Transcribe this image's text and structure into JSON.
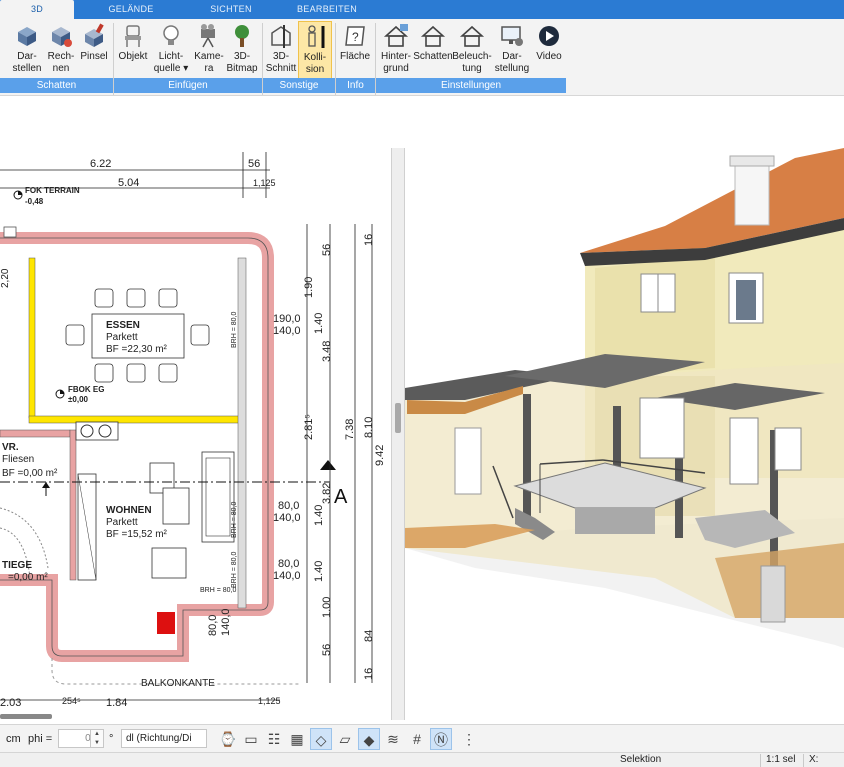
{
  "tabs": [
    {
      "label": "3D",
      "active": true
    },
    {
      "label": "GELÄNDE",
      "active": false
    },
    {
      "label": "SICHTEN",
      "active": false
    },
    {
      "label": "BEARBEITEN",
      "active": false
    }
  ],
  "ribbon": {
    "buttons": [
      {
        "l1": "Dar-",
        "l2": "stellen",
        "icon": "cube-display-icon"
      },
      {
        "l1": "Rech-",
        "l2": "nen",
        "icon": "cube-calculate-icon"
      },
      {
        "l1": "Pinsel",
        "l2": "",
        "icon": "brush-cube-icon"
      },
      {
        "l1": "Objekt",
        "l2": "",
        "icon": "chair-object-icon"
      },
      {
        "l1": "Licht-",
        "l2": "quelle ▾",
        "icon": "lightbulb-icon"
      },
      {
        "l1": "Kame-",
        "l2": "ra",
        "icon": "camera-icon"
      },
      {
        "l1": "3D-",
        "l2": "Bitmap",
        "icon": "tree-bitmap-icon"
      },
      {
        "l1": "3D-",
        "l2": "Schnitt",
        "icon": "section-cut-icon"
      },
      {
        "l1": "Kolli-",
        "l2": "sion",
        "icon": "collision-person-icon",
        "active": true
      },
      {
        "l1": "Fläche",
        "l2": "",
        "icon": "area-info-icon"
      },
      {
        "l1": "Hinter-",
        "l2": "grund",
        "icon": "house-background-icon"
      },
      {
        "l1": "Schatten",
        "l2": "",
        "icon": "house-shadow-icon"
      },
      {
        "l1": "Beleuch-",
        "l2": "tung",
        "icon": "house-lighting-icon"
      },
      {
        "l1": "Dar-",
        "l2": "stellung",
        "icon": "monitor-settings-icon"
      },
      {
        "l1": "Video",
        "l2": "",
        "icon": "video-play-icon"
      }
    ],
    "groups": [
      "Schatten",
      "Einfügen",
      "Sonstige",
      "Info",
      "Einstellungen"
    ]
  },
  "plan": {
    "top_dims": [
      "6.22",
      "5.04",
      "56",
      "1,125"
    ],
    "terrain_label": "FOK TERRAIN",
    "terrain_value": "-0,48",
    "left_dim": "2,20",
    "rooms": [
      {
        "name": "ESSEN",
        "floor": "Parkett",
        "area": "BF =22,30 m²"
      },
      {
        "name": "WOHNEN",
        "floor": "Parkett",
        "area": "BF =15,52 m²"
      },
      {
        "name": "VR.",
        "floor": "Fliesen",
        "area": "BF =0,00 m²"
      },
      {
        "name": "TIEGE",
        "floor": "",
        "area": "=0,00 m²"
      }
    ],
    "fbok_label": "FBOK EG",
    "fbok_value": "±0,00",
    "window_labels": [
      "190,0",
      "140,0",
      "80,0",
      "140,0",
      "80,0",
      "140,0",
      "80,0",
      "140,0"
    ],
    "brh_labels": [
      "BRH = 80,0",
      "BRH = 80,0",
      "BRH = 80,0",
      "BRH = 80,0"
    ],
    "right_dims": [
      "16",
      "56",
      "1.90",
      "1.40",
      "3.48",
      "2.81⁵",
      "7.38",
      "8.10",
      "9.42",
      "3.82",
      "1.40",
      "1.40",
      "1.00",
      "84",
      "56",
      "16"
    ],
    "section_label": "A",
    "balcony_label": "BALKONKANTE",
    "bottom_dims": [
      "2.03",
      "254⁵",
      "1.84",
      "1,125"
    ]
  },
  "bottom_toolbar": {
    "unit": "cm",
    "phi_label": "phi =",
    "phi_value": "0,0",
    "degree": "°",
    "direction": "dl (Richtung/Di"
  },
  "status": {
    "mode": "Selektion",
    "scale": "1:1 sel",
    "x_label": "X:"
  },
  "colors": {
    "tab_blue": "#2b7bd3",
    "group_blue": "#5aa0ea",
    "wall_pink": "#e8a3a3",
    "wall_yellow": "#ffe600",
    "roof_orange": "#d77f45",
    "wall_cream": "#efe8b5"
  }
}
